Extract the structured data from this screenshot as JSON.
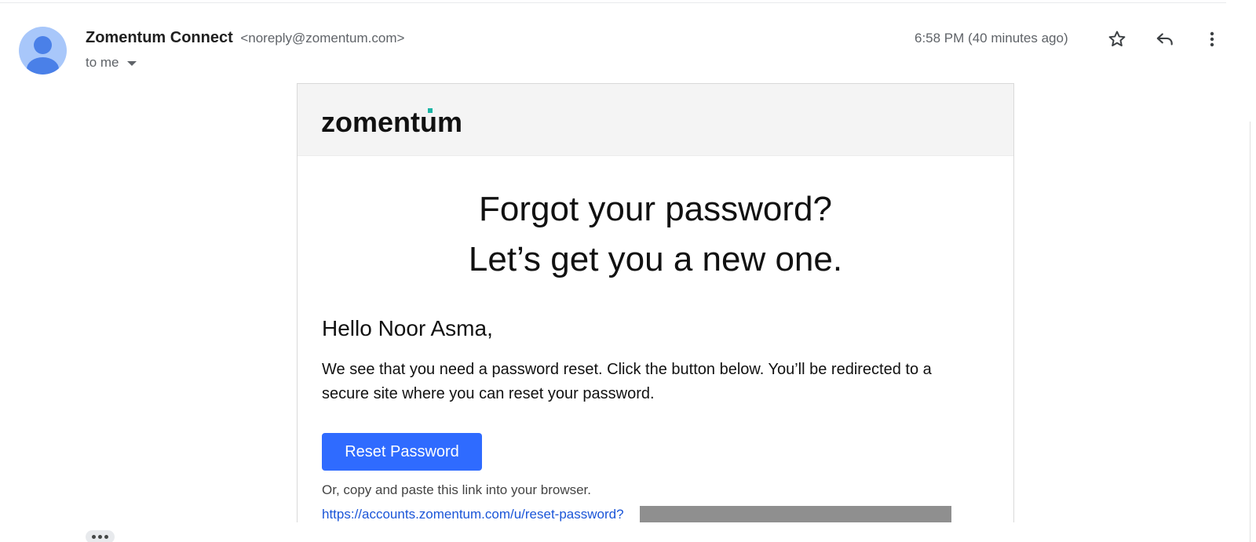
{
  "message": {
    "sender_name": "Zomentum Connect",
    "sender_email": "<noreply@zomentum.com>",
    "recipient_label": "to me",
    "timestamp": "6:58 PM (40 minutes ago)"
  },
  "icons": {
    "avatar": "person-avatar-icon",
    "recipients_toggle": "caret-down-icon",
    "star": "star-outline-icon",
    "reply": "reply-icon",
    "more": "more-vertical-icon",
    "trimmed_content": "ellipsis-icon"
  },
  "email_body": {
    "logo_text": "zomentum",
    "headline_line1": "Forgot your password?",
    "headline_line2": "Let’s get you a new one.",
    "greeting": "Hello Noor Asma,",
    "paragraph": "We see that you need a password reset. Click the button below. You’ll be redirected to a secure site where you can reset your password.",
    "button_label": "Reset Password",
    "copy_instruction": "Or, copy and paste this link into your browser.",
    "reset_link": "https://accounts.zomentum.com/u/reset-password?"
  },
  "colors": {
    "button": "#2f6bff",
    "link": "#1a55d8",
    "avatar_bg": "#a8c7fa",
    "avatar_fg": "#4a80e8",
    "logo_accent": "#1ab5a5",
    "header_bg": "#f4f4f4"
  }
}
